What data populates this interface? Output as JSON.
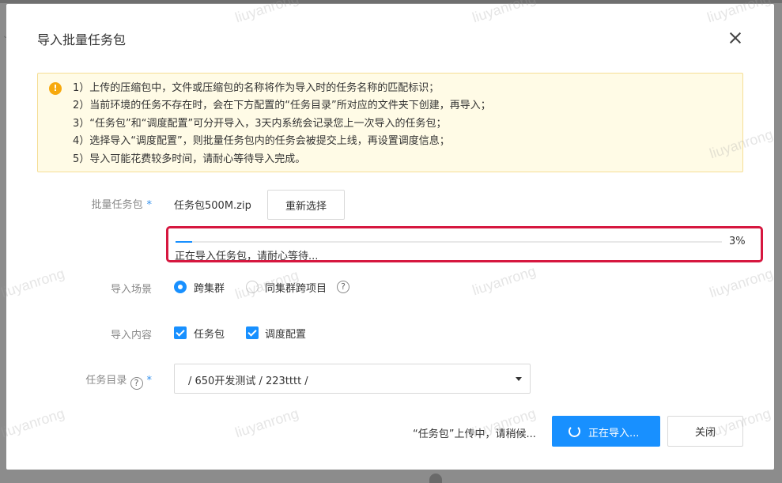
{
  "dialog": {
    "title": "导入批量任务包",
    "notice": {
      "lines": [
        "1）上传的压缩包中，文件或压缩包的名称将作为导入时的任务名称的匹配标识；",
        "2）当前环境的任务不存在时，会在下方配置的“任务目录”所对应的文件夹下创建，再导入；",
        "3）“任务包”和“调度配置”可分开导入，3天内系统会记录您上一次导入的任务包；",
        "4）选择导入“调度配置”，则批量任务包内的任务会被提交上线，再设置调度信息；",
        "5）导入可能花费较多时间，请耐心等待导入完成。"
      ]
    },
    "package": {
      "label": "批量任务包",
      "file_name": "任务包500M.zip",
      "reselect_label": "重新选择"
    },
    "progress": {
      "percent": 3,
      "percent_text": "3%",
      "status_text": "正在导入任务包，请耐心等待..."
    },
    "scene": {
      "label": "导入场景",
      "options": [
        {
          "label": "跨集群",
          "selected": true
        },
        {
          "label": "同集群跨项目",
          "selected": false
        }
      ],
      "help_icon": "?"
    },
    "content": {
      "label": "导入内容",
      "options": [
        {
          "label": "任务包",
          "checked": true
        },
        {
          "label": "调度配置",
          "checked": true
        }
      ]
    },
    "directory": {
      "label": "任务目录",
      "help_icon": "?",
      "value": "/ 650开发测试 / 223tttt /"
    },
    "footer": {
      "upload_status": "“任务包”上传中，请稍候...",
      "primary_label": "正在导入...",
      "close_label": "关闭"
    },
    "required_mark": "*",
    "warning_icon": "!"
  },
  "watermark": "liuyanrong",
  "colors": {
    "primary": "#1890ff",
    "highlight_border": "#d6173f",
    "notice_bg": "#fffbe6",
    "notice_border": "#f5de95",
    "warning": "#f7a90e"
  }
}
